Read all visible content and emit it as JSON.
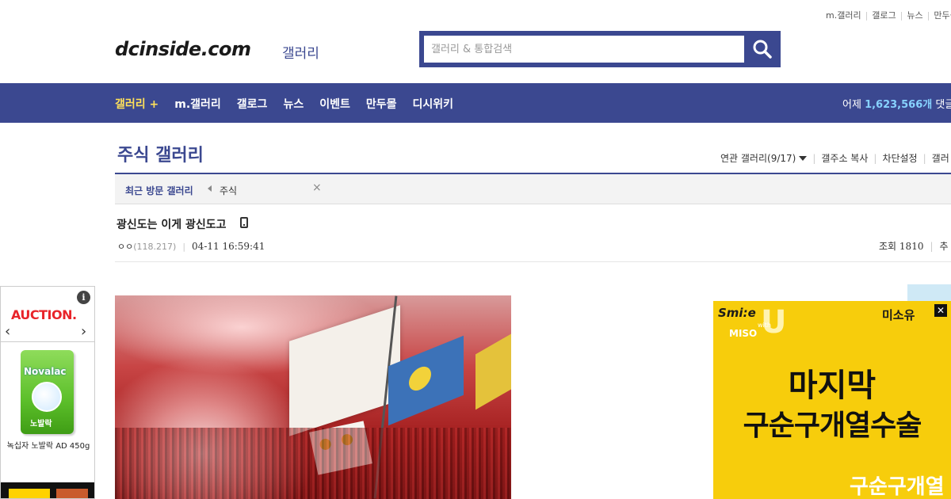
{
  "util_links": [
    "m.갤러리",
    "갤로그",
    "뉴스",
    "만두몰"
  ],
  "logo": {
    "text": "dcinside.com",
    "sub": "갤러리"
  },
  "search": {
    "placeholder": "갤러리 & 통합검색",
    "value": ""
  },
  "nav": {
    "items": [
      "갤러리 +",
      "m.갤러리",
      "갤로그",
      "뉴스",
      "이벤트",
      "만두몰",
      "디시위키"
    ],
    "stat_prefix": "어제",
    "stat_value": "1,623,566개",
    "stat_suffix": "댓글"
  },
  "gallery": {
    "title": "주식 갤러리",
    "related": "연관 갤러리(9/17)",
    "copy_addr": "갤주소 복사",
    "block_settings": "차단설정",
    "more": "갤러"
  },
  "recent": {
    "label": "최근 방문 갤러리",
    "items": [
      "주식"
    ],
    "close": "×"
  },
  "post": {
    "title": "광신도는 이게 광신도고",
    "writer": "ㅇㅇ",
    "ip": "(118.217)",
    "date": "04-11 16:59:41",
    "views_label": "조회",
    "views": "1810",
    "recommend_label": "추"
  },
  "left_ad": {
    "brand": "AUCTION.",
    "info": "i",
    "product_brand": "Novalac",
    "product_ko": "노발락",
    "product_name": "녹십자 노발락 AD 450g"
  },
  "right_ad": {
    "smile": "Smi:e",
    "with": "with",
    "miso": "MISO",
    "u": "U",
    "clinic": "미소유",
    "close": "✕",
    "headline1": "마지막",
    "headline2": "구순구개열수술",
    "footer": "구순구개열"
  },
  "colors": {
    "brand": "#3b4890",
    "nav_active": "#ffe15a",
    "stat_highlight": "#87d2ff",
    "ad_yellow": "#f7cd0c"
  }
}
